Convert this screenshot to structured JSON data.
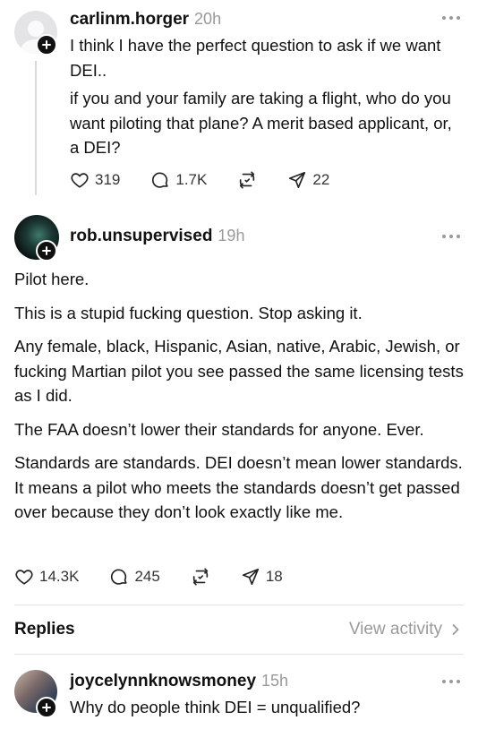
{
  "posts": [
    {
      "username": "carlinm.horger",
      "time": "20h",
      "paragraphs": [
        "I think I have the perfect question to ask if we want DEI..",
        "if you and your family are taking a flight, who do you want piloting that plane? A merit based applicant, or, a DEI?"
      ],
      "likes": "319",
      "comments": "1.7K",
      "shares": "22"
    },
    {
      "username": "rob.unsupervised",
      "time": "19h",
      "paragraphs": [
        "Pilot here.",
        "This is a stupid fucking question.  Stop asking it.",
        "Any female, black, Hispanic, Asian, native, Arabic, Jewish, or fucking Martian pilot you see passed the same licensing tests as I did.",
        "The FAA doesn’t lower their standards for anyone.  Ever.",
        "Standards are standards.  DEI doesn’t mean lower standards.  It means a pilot who meets the standards doesn’t get passed over because they don’t look exactly like me."
      ],
      "likes": "14.3K",
      "comments": "245",
      "shares": "18"
    },
    {
      "username": "joycelynnknowsmoney",
      "time": "15h",
      "paragraphs": [
        "Why do people think DEI = unqualified?"
      ]
    }
  ],
  "replies": {
    "label": "Replies",
    "view_activity": "View activity"
  },
  "colors": {
    "text": "#111111",
    "muted": "#999999",
    "divider": "#e3e3e3"
  }
}
